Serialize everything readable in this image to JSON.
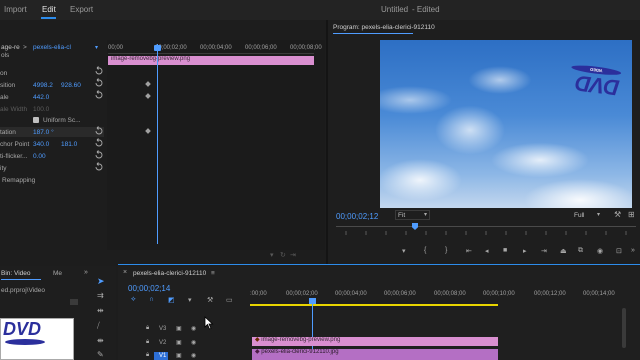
{
  "menu": {
    "import_label": "Import",
    "edit_label": "Edit",
    "export_label": "Export",
    "window_title": "Untitled",
    "edited_label": "- Edited"
  },
  "effect_controls": {
    "tab_prefix": "age-re",
    "clip_name": "pexels-elia-cl",
    "tab_suffix": "ols",
    "section_label": "on",
    "position_label": "sition",
    "position_x": "4998.2",
    "position_y": "928.60",
    "scale_label": "ale",
    "scale_value": "442.0",
    "scale_width_label": "ale Width",
    "scale_width_value": "100.0",
    "uniform_scale_label": "Uniform Sc...",
    "rotation_label": "tation",
    "rotation_value": "187.0 °",
    "anchor_label": "chor Point",
    "anchor_x": "340.0",
    "anchor_y": "181.0",
    "antiflicker_label": "ti-flicker...",
    "antiflicker_value": "0.00",
    "opacity_label": "ity",
    "remapping_label": "Remapping"
  },
  "ec_timeline": {
    "ruler_labels": [
      "00;00",
      "00;00;02;00",
      "00;00;04;00",
      "00;00;06;00",
      "00;00;08;00",
      "00;00;10;00"
    ],
    "clip_label": "image-removebg-preview.png"
  },
  "program": {
    "title": "Program: pexels-elia-clerici-912110",
    "timecode": "00;00;02;12",
    "fit_label": "Fit",
    "full_label": "Full",
    "logo_text": "DVD",
    "logo_sub": "VIDEO"
  },
  "project": {
    "tab_label": "Bin: Video",
    "tab2_label": "Me",
    "path_label": "ed.prproj\\Video",
    "thumb_logo": "DVD"
  },
  "timeline": {
    "sequence_name": "pexels-elia-clerici-912110",
    "timecode": "00;00;02;14",
    "ruler_labels": [
      ":00;00",
      "00;00;02;00",
      "00;00;04;00",
      "00;00;06;00",
      "00;00;08;00",
      "00;00;10;00",
      "00;00;12;00",
      "00;00;14;00"
    ],
    "track_v3": "V3",
    "track_v2": "V2",
    "track_v1": "V1",
    "clip_v2": "image-removebg-preview.png",
    "clip_v1": "pexels-elia-clerici-912110.jpg"
  },
  "colors": {
    "accent": "#2d8ceb",
    "timecode": "#4f9cff",
    "clip_pink": "#d98fd0",
    "clip_v1": "#b46fc4",
    "workarea": "#e8d400"
  }
}
